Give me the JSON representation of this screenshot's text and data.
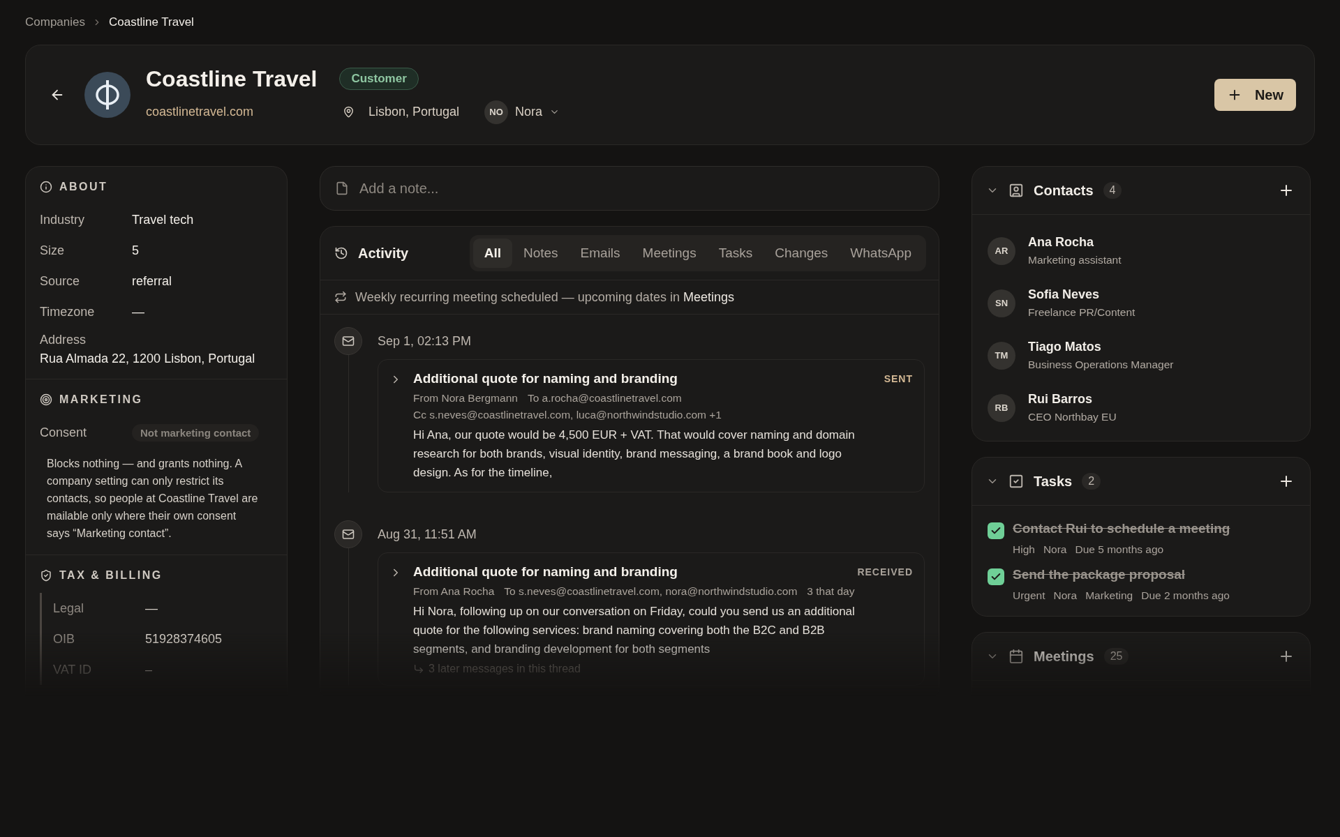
{
  "breadcrumb": [
    {
      "label": "Companies"
    },
    {
      "label": "Coastline Travel"
    }
  ],
  "header": {
    "name": "Coastline Travel",
    "status": "Customer",
    "website": "coastlinetravel.com",
    "location": "Lisbon, Portugal",
    "owner_initials": "NO",
    "owner": "Nora",
    "new_button": "New"
  },
  "about": {
    "title": "ABOUT",
    "fields": [
      {
        "label": "Industry",
        "value": "Travel tech"
      },
      {
        "label": "Size",
        "value": "5"
      },
      {
        "label": "Source",
        "value": "referral"
      },
      {
        "label": "Timezone",
        "value": "—"
      }
    ],
    "address_label": "Address",
    "address": "Rua Almada 22, 1200 Lisbon, Portugal"
  },
  "marketing": {
    "title": "MARKETING",
    "consent_label": "Consent",
    "consent": "Not marketing contact",
    "note": "Blocks nothing — and grants nothing. A company setting can only restrict its contacts, so people at Coastline Travel are mailable only where their own consent says “Marketing contact”."
  },
  "tax_billing": {
    "title": "TAX & BILLING",
    "fields": [
      {
        "label": "Legal",
        "value": "—"
      },
      {
        "label": "OIB",
        "value": "51928374605"
      },
      {
        "label": "VAT ID",
        "value": "–"
      }
    ]
  },
  "note_field": {
    "placeholder": "Add a note..."
  },
  "activity": {
    "title": "Activity",
    "tabs": [
      {
        "label": "All",
        "selected": true
      },
      {
        "label": "Notes",
        "selected": false
      },
      {
        "label": "Emails",
        "selected": false
      },
      {
        "label": "Meetings",
        "selected": false
      },
      {
        "label": "Tasks",
        "selected": false
      },
      {
        "label": "Changes",
        "selected": false
      },
      {
        "label": "WhatsApp",
        "selected": false
      }
    ],
    "banner": {
      "text": "Weekly recurring meeting scheduled — upcoming dates in ",
      "link": "Meetings"
    },
    "items": [
      {
        "time": "Sep 1, 02:13 PM",
        "subject": "Additional quote for naming and branding",
        "direction": "SENT",
        "kind": "sent",
        "meta": [
          "From Nora Bergmann",
          "To a.rocha@coastlinetravel.com"
        ],
        "cc": "Cc s.neves@coastlinetravel.com, luca@northwindstudio.com +1",
        "body": "Hi Ana, our quote would be 4,500 EUR + VAT. That would cover naming and domain research for both brands, visual identity, brand messaging, a brand book and logo design. As for the timeline,"
      },
      {
        "time": "Aug 31, 11:51 AM",
        "subject": "Additional quote for naming and branding",
        "direction": "RECEIVED",
        "kind": "received",
        "meta": [
          "From Ana Rocha",
          "To s.neves@coastlinetravel.com, nora@northwindstudio.com",
          "3 that day"
        ],
        "body": "Hi Nora, following up on our conversation on Friday, could you send us an additional quote for the following services: brand naming covering both the B2C and B2B segments, and branding development for both segments",
        "thread": "3 later messages in this thread"
      }
    ]
  },
  "contacts": {
    "title": "Contacts",
    "count": "4",
    "expanded": true,
    "items": [
      {
        "initials": "AR",
        "name": "Ana Rocha",
        "role": "Marketing assistant"
      },
      {
        "initials": "SN",
        "name": "Sofia Neves",
        "role": "Freelance PR/Content"
      },
      {
        "initials": "TM",
        "name": "Tiago Matos",
        "role": "Business Operations Manager"
      },
      {
        "initials": "RB",
        "name": "Rui Barros",
        "role": "CEO Northbay EU"
      }
    ]
  },
  "tasks": {
    "title": "Tasks",
    "count": "2",
    "expanded": true,
    "items": [
      {
        "title": "Contact Rui to schedule a meeting",
        "checked": true,
        "tags": [
          "High",
          "Nora",
          "Due 5 months ago"
        ]
      },
      {
        "title": "Send the package proposal",
        "checked": true,
        "tags": [
          "Urgent",
          "Nora",
          "Marketing",
          "Due 2 months ago"
        ]
      }
    ]
  },
  "meetings": {
    "title": "Meetings",
    "count": "25",
    "expanded": true
  }
}
